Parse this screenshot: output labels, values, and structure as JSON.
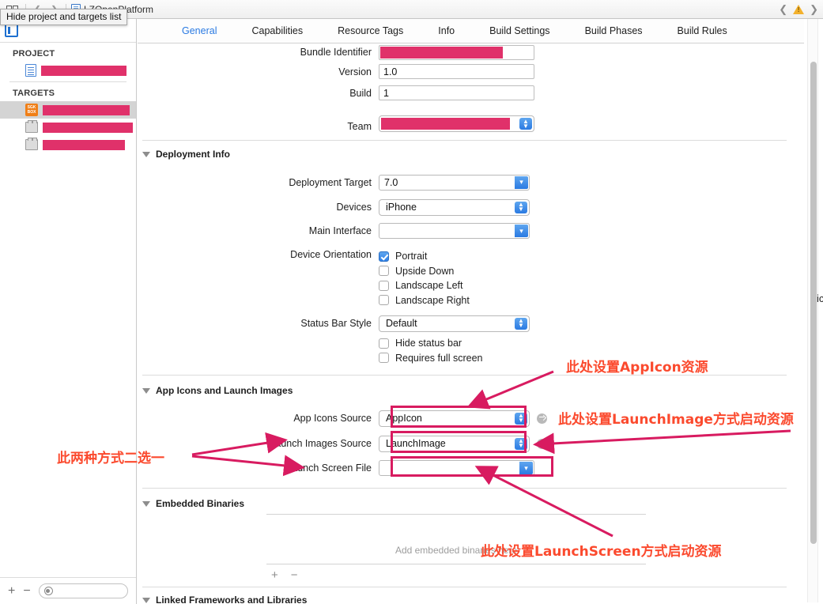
{
  "window": {
    "tooltip": "Hide project and targets list",
    "breadcrumb_project": "LZOpenPlatform"
  },
  "tabs": [
    {
      "label": "General",
      "active": true
    },
    {
      "label": "Capabilities",
      "active": false
    },
    {
      "label": "Resource Tags",
      "active": false
    },
    {
      "label": "Info",
      "active": false
    },
    {
      "label": "Build Settings",
      "active": false
    },
    {
      "label": "Build Phases",
      "active": false
    },
    {
      "label": "Build Rules",
      "active": false
    }
  ],
  "sidebar": {
    "project_header": "PROJECT",
    "targets_header": "TARGETS",
    "project_items": [
      {
        "label": "",
        "redacted": true
      }
    ],
    "target_items": [
      {
        "label": "",
        "redacted": true,
        "selected": true
      },
      {
        "label": "",
        "redacted": true,
        "selected": false
      },
      {
        "label": "",
        "redacted": true,
        "selected": false
      }
    ],
    "footer": {
      "add": "+",
      "remove": "−",
      "filter_placeholder": ""
    }
  },
  "identity": {
    "bundle_identifier_label": "Bundle Identifier",
    "bundle_identifier_value": "",
    "version_label": "Version",
    "version_value": "1.0",
    "build_label": "Build",
    "build_value": "1",
    "team_label": "Team",
    "team_value": ""
  },
  "deployment_info": {
    "section_title": "Deployment Info",
    "deployment_target_label": "Deployment Target",
    "deployment_target_value": "7.0",
    "devices_label": "Devices",
    "devices_value": "iPhone",
    "main_interface_label": "Main Interface",
    "main_interface_value": "",
    "device_orientation_label": "Device Orientation",
    "orientations": [
      {
        "label": "Portrait",
        "checked": true
      },
      {
        "label": "Upside Down",
        "checked": false
      },
      {
        "label": "Landscape Left",
        "checked": false
      },
      {
        "label": "Landscape Right",
        "checked": false
      }
    ],
    "status_bar_style_label": "Status Bar Style",
    "status_bar_style_value": "Default",
    "extra_options": [
      {
        "label": "Hide status bar",
        "checked": false
      },
      {
        "label": "Requires full screen",
        "checked": false
      }
    ]
  },
  "app_icons": {
    "section_title": "App Icons and Launch Images",
    "app_icons_source_label": "App Icons Source",
    "app_icons_source_value": "AppIcon",
    "launch_images_source_label": "Launch Images Source",
    "launch_images_source_value": "LaunchImage",
    "launch_screen_file_label": "Launch Screen File",
    "launch_screen_file_value": ""
  },
  "embedded_binaries": {
    "section_title": "Embedded Binaries",
    "empty_hint": "Add embedded binaries here",
    "add": "+",
    "remove": "−"
  },
  "linked_frameworks": {
    "section_title": "Linked Frameworks and Libraries"
  },
  "annotations": [
    {
      "id": "appicon",
      "text": "此处设置AppIcon资源"
    },
    {
      "id": "launchimage",
      "text": "此处设置LaunchImage方式启动资源"
    },
    {
      "id": "two-choose-one",
      "text": "此两种方式二选一"
    },
    {
      "id": "launchscreen",
      "text": "此处设置LaunchScreen方式启动资源"
    }
  ],
  "colors": {
    "accent_blue": "#2a7ae2",
    "redaction_pink": "#e0316a",
    "annotation_box": "#d81b60",
    "annotation_text": "#fb4a2e",
    "warning_amber": "#f3b12c"
  },
  "right_edge_clipped_text": "ic"
}
